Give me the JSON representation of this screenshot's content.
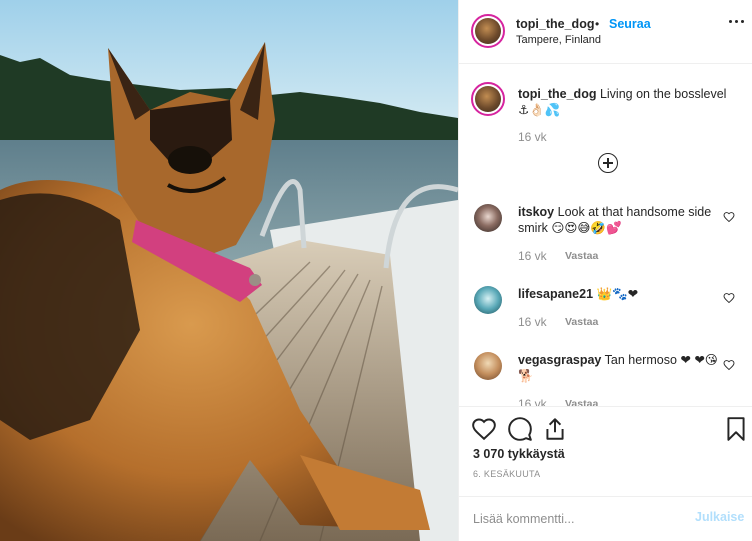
{
  "post": {
    "username": "topi_the_dog",
    "separator": "•",
    "follow_label": "Seuraa",
    "location": "Tampere, Finland"
  },
  "caption": {
    "username": "topi_the_dog",
    "text": "Living on the bosslevel ⚓👌🏻💦",
    "time": "16 vk"
  },
  "comments": [
    {
      "username": "itskoy",
      "text": "Look at that handsome side smirk 😏😍😅🤣💕",
      "time": "16 vk",
      "reply_label": "Vastaa"
    },
    {
      "username": "lifesapane21",
      "text": "👑🐾❤",
      "time": "16 vk",
      "reply_label": "Vastaa"
    },
    {
      "username": "vegasgraspay",
      "text": "Tan hermoso ❤ ❤😘🐕",
      "time": "16 vk",
      "reply_label": "Vastaa"
    }
  ],
  "stats": {
    "likes": "3 070 tykkäystä",
    "date": "6. KESÄKUUTA"
  },
  "composer": {
    "placeholder": "Lisää kommentti...",
    "post_label": "Julkaise"
  },
  "colors": {
    "accent": "#0095f6",
    "post_disabled": "#b2dffc",
    "story_ring": "#d6249f"
  }
}
